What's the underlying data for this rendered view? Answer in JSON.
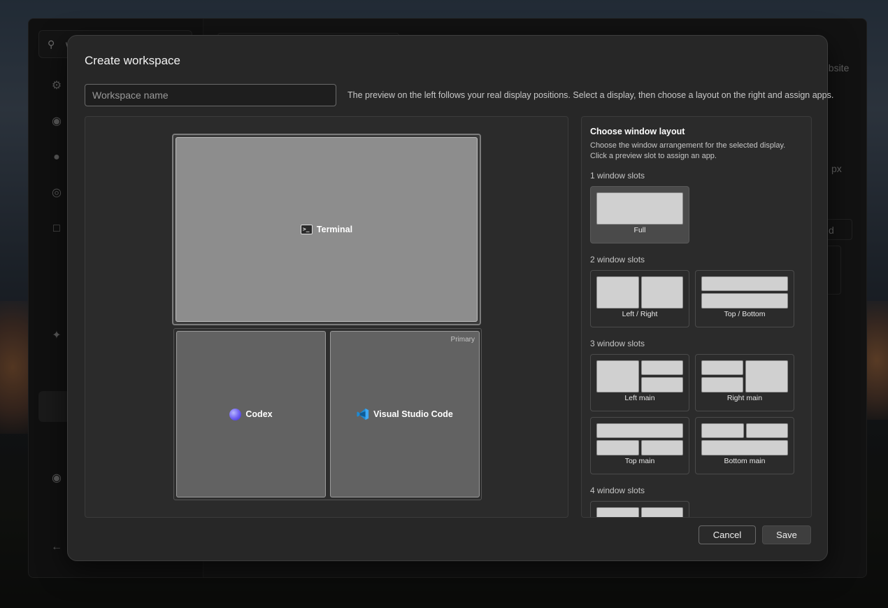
{
  "background_app": {
    "search_text": "w",
    "header_fragment": "ebsite",
    "unit_fragment": "px",
    "button_fragment": "d"
  },
  "dialog": {
    "title": "Create workspace",
    "name_placeholder": "Workspace name",
    "name_value": "",
    "hint": "The preview on the left follows your real display positions. Select a display, then choose a layout on the right and assign apps."
  },
  "preview": {
    "top_display": {
      "slots": [
        {
          "app": "Terminal",
          "icon": "terminal-icon"
        }
      ]
    },
    "bottom_display": {
      "tag": "Primary",
      "slots": [
        {
          "app": "Codex",
          "icon": "codex-icon"
        },
        {
          "app": "Visual Studio Code",
          "icon": "vscode-icon"
        }
      ]
    }
  },
  "layout_panel": {
    "title": "Choose window layout",
    "description_line1": "Choose the window arrangement for the selected display.",
    "description_line2": "Click a preview slot to assign an app.",
    "groups": [
      {
        "label": "1 window slots",
        "options": [
          "Full"
        ]
      },
      {
        "label": "2 window slots",
        "options": [
          "Left / Right",
          "Top / Bottom"
        ]
      },
      {
        "label": "3 window slots",
        "options": [
          "Left main",
          "Right main",
          "Top main",
          "Bottom main"
        ]
      },
      {
        "label": "4 window slots",
        "options": [
          ""
        ]
      }
    ],
    "selected": "Full"
  },
  "footer": {
    "cancel_label": "Cancel",
    "save_label": "Save"
  },
  "colors": {
    "dialog_bg": "#272727",
    "selected_option_bg": "#4a4a4a",
    "terminal_slot": "#8d8d8d",
    "slot": "#626262"
  }
}
